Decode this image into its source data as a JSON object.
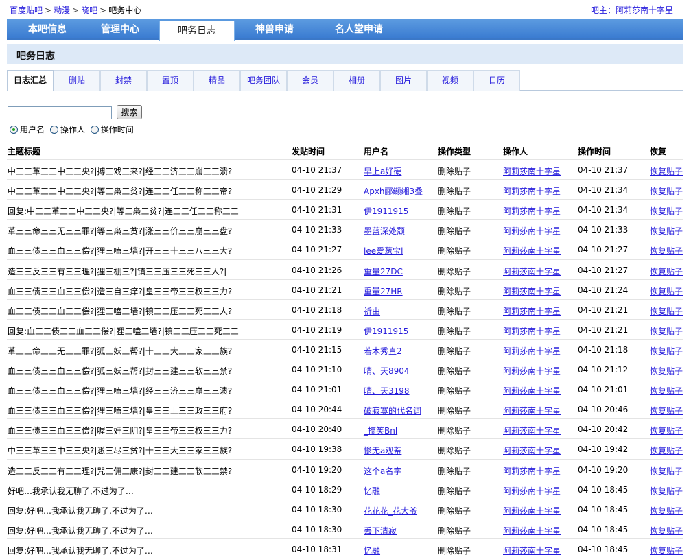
{
  "breadcrumb": {
    "items": [
      "百度贴吧",
      "动漫",
      "晓吧"
    ],
    "current": "吧务中心",
    "separator": ">"
  },
  "owner": {
    "label": "吧主：",
    "name": "阿莉莎南十字星"
  },
  "main_tabs": [
    {
      "label": "本吧信息",
      "active": false
    },
    {
      "label": "管理中心",
      "active": false
    },
    {
      "label": "吧务日志",
      "active": true
    },
    {
      "label": "神兽申请",
      "active": false
    },
    {
      "label": "名人堂申请",
      "active": false
    }
  ],
  "section_title": "吧务日志",
  "sub_tabs": [
    {
      "label": "日志汇总",
      "active": true
    },
    {
      "label": "删贴",
      "active": false
    },
    {
      "label": "封禁",
      "active": false
    },
    {
      "label": "置顶",
      "active": false
    },
    {
      "label": "精品",
      "active": false
    },
    {
      "label": "吧务团队",
      "active": false
    },
    {
      "label": "会员",
      "active": false
    },
    {
      "label": "相册",
      "active": false
    },
    {
      "label": "图片",
      "active": false
    },
    {
      "label": "视频",
      "active": false
    },
    {
      "label": "日历",
      "active": false
    }
  ],
  "search": {
    "value": "",
    "button_label": "搜索"
  },
  "search_by": {
    "selected": "用户名",
    "options": [
      "用户名",
      "操作人",
      "操作时间"
    ]
  },
  "table": {
    "headers": {
      "title": "主题标题",
      "post_time": "发贴时间",
      "user": "用户名",
      "op_type": "操作类型",
      "operator": "操作人",
      "op_time": "操作时间",
      "recover": "恢复"
    },
    "rows": [
      {
        "title": "中三三革三三中三三央?|搏三戏三来?|经三三济三三崩三三溃?",
        "post_time": "04-10 21:37",
        "user": "早上a好硬",
        "op_type": "删除贴子",
        "operator": "阿莉莎南十字星",
        "op_time": "04-10 21:37",
        "recover": "恢复贴子"
      },
      {
        "title": "中三三革三三中三三央?|等三枭三贫?|连三三任三三称三三帝?",
        "post_time": "04-10 21:29",
        "user": "Apxh郦缬缃3叠",
        "op_type": "删除贴子",
        "operator": "阿莉莎南十字星",
        "op_time": "04-10 21:34",
        "recover": "恢复贴子"
      },
      {
        "title": "回复:中三三革三三中三三央?|等三枭三贫?|连三三任三三称三三",
        "post_time": "04-10 21:31",
        "user": "伊1911915",
        "op_type": "删除贴子",
        "operator": "阿莉莎南十字星",
        "op_time": "04-10 21:34",
        "recover": "恢复贴子"
      },
      {
        "title": "革三三命三三无三三罪?|等三枭三贫?|涨三三价三三崩三三盘?",
        "post_time": "04-10 21:33",
        "user": "墨蓝深处颓",
        "op_type": "删除贴子",
        "operator": "阿莉莎南十字星",
        "op_time": "04-10 21:33",
        "recover": "恢复贴子"
      },
      {
        "title": "血三三债三三血三三偿?|狸三嗑三墙?|开三三十三三八三三大?",
        "post_time": "04-10 21:27",
        "user": "lee爱葱宝l",
        "op_type": "删除贴子",
        "operator": "阿莉莎南十字星",
        "op_time": "04-10 21:27",
        "recover": "恢复贴子"
      },
      {
        "title": "造三三反三三有三三理?|狸三棚三?|镇三三压三三死三三人?|",
        "post_time": "04-10 21:26",
        "user": "重量27DC",
        "op_type": "删除贴子",
        "operator": "阿莉莎南十字星",
        "op_time": "04-10 21:27",
        "recover": "恢复贴子"
      },
      {
        "title": "血三三债三三血三三偿?|造三自三痒?|皇三三帝三三权三三力?",
        "post_time": "04-10 21:21",
        "user": "重量27HR",
        "op_type": "删除贴子",
        "operator": "阿莉莎南十字星",
        "op_time": "04-10 21:24",
        "recover": "恢复贴子"
      },
      {
        "title": "血三三债三三血三三偿?|狸三嗑三墙?|镇三三压三三死三三人?",
        "post_time": "04-10 21:18",
        "user": "祈由",
        "op_type": "删除贴子",
        "operator": "阿莉莎南十字星",
        "op_time": "04-10 21:21",
        "recover": "恢复贴子"
      },
      {
        "title": "回复:血三三债三三血三三偿?|狸三嗑三墙?|镇三三压三三死三三",
        "post_time": "04-10 21:19",
        "user": "伊1911915",
        "op_type": "删除贴子",
        "operator": "阿莉莎南十字星",
        "op_time": "04-10 21:21",
        "recover": "恢复贴子"
      },
      {
        "title": "革三三命三三无三三罪?|狐三妖三帮?|十三三大三三家三三族?",
        "post_time": "04-10 21:15",
        "user": "若木秀直2",
        "op_type": "删除贴子",
        "operator": "阿莉莎南十字星",
        "op_time": "04-10 21:18",
        "recover": "恢复贴子"
      },
      {
        "title": "血三三债三三血三三偿?|狐三妖三帮?|封三三建三三软三三禁?",
        "post_time": "04-10 21:10",
        "user": "晴、天8904",
        "op_type": "删除贴子",
        "operator": "阿莉莎南十字星",
        "op_time": "04-10 21:12",
        "recover": "恢复贴子"
      },
      {
        "title": "血三三债三三血三三偿?|狸三嗑三墙?|经三三济三三崩三三溃?",
        "post_time": "04-10 21:01",
        "user": "晴、天3198",
        "op_type": "删除贴子",
        "operator": "阿莉莎南十字星",
        "op_time": "04-10 21:01",
        "recover": "恢复贴子"
      },
      {
        "title": "血三三债三三血三三偿?|狸三嗑三墙?|皇三三上三三政三三府?",
        "post_time": "04-10 20:44",
        "user": "破寂寞的代名词",
        "op_type": "删除贴子",
        "operator": "阿莉莎南十字星",
        "op_time": "04-10 20:46",
        "recover": "恢复贴子"
      },
      {
        "title": "血三三债三三血三三偿?|喔三奸三阴?|皇三三帝三三权三三力?",
        "post_time": "04-10 20:40",
        "user": "_搞笑Bnl",
        "op_type": "删除贴子",
        "operator": "阿莉莎南十字星",
        "op_time": "04-10 20:42",
        "recover": "恢复贴子"
      },
      {
        "title": "中三三革三三中三三央?|悉三尽三贫?|十三三大三三家三三族?",
        "post_time": "04-10 19:38",
        "user": "惨无a观蒂",
        "op_type": "删除贴子",
        "operator": "阿莉莎南十字星",
        "op_time": "04-10 19:42",
        "recover": "恢复贴子"
      },
      {
        "title": "造三三反三三有三三理?|咒三佣三康?|封三三建三三软三三禁?",
        "post_time": "04-10 19:20",
        "user": "这个a名字",
        "op_type": "删除贴子",
        "operator": "阿莉莎南十字星",
        "op_time": "04-10 19:20",
        "recover": "恢复贴子"
      },
      {
        "title": "好吧…我承认我无聊了,不过为了…",
        "post_time": "04-10 18:29",
        "user": "忆融",
        "op_type": "删除贴子",
        "operator": "阿莉莎南十字星",
        "op_time": "04-10 18:45",
        "recover": "恢复贴子"
      },
      {
        "title": "回复:好吧…我承认我无聊了,不过为了…",
        "post_time": "04-10 18:30",
        "user": "花花花_花大爷",
        "op_type": "删除贴子",
        "operator": "阿莉莎南十字星",
        "op_time": "04-10 18:45",
        "recover": "恢复贴子"
      },
      {
        "title": "回复:好吧…我承认我无聊了,不过为了…",
        "post_time": "04-10 18:30",
        "user": "丢下清寂",
        "op_type": "删除贴子",
        "operator": "阿莉莎南十字星",
        "op_time": "04-10 18:45",
        "recover": "恢复贴子"
      },
      {
        "title": "回复:好吧…我承认我无聊了,不过为了…",
        "post_time": "04-10 18:31",
        "user": "忆融",
        "op_type": "删除贴子",
        "operator": "阿莉莎南十字星",
        "op_time": "04-10 18:45",
        "recover": "恢复贴子"
      }
    ]
  },
  "colors": {
    "link": "#261cdc",
    "nav_blue": "#3a7bd1",
    "section_bg": "#dde9f7",
    "radio_dot": "#21a121"
  }
}
